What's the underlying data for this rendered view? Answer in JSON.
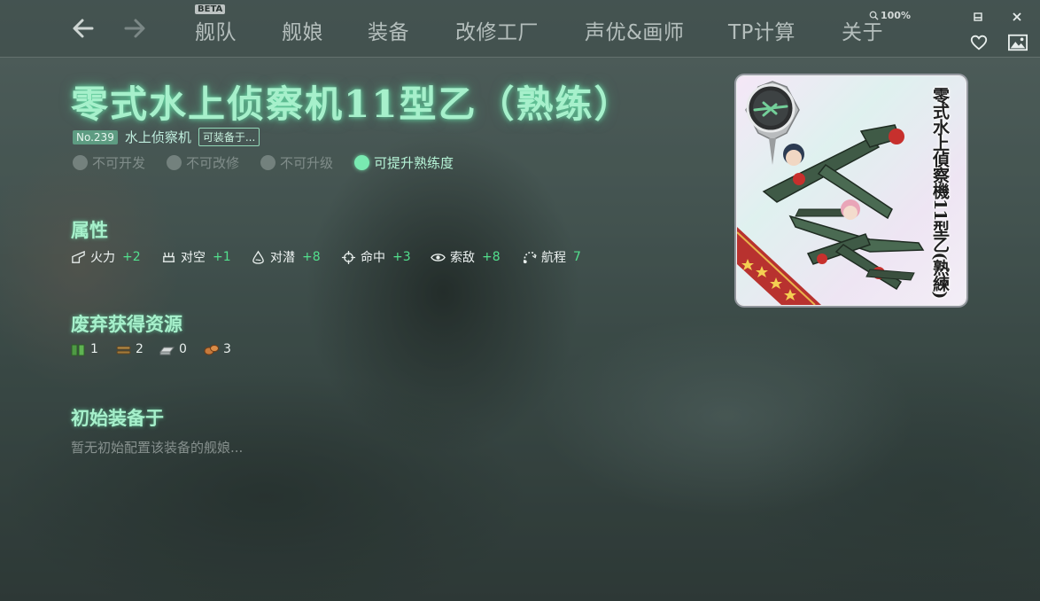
{
  "nav": {
    "beta_badge": "BETA",
    "tabs": [
      "舰队",
      "舰娘",
      "装备",
      "改修工厂",
      "声优&画师",
      "TP计算",
      "关于"
    ],
    "zoom": "100%"
  },
  "equipment": {
    "name": "零式水上侦察机11型乙（熟练）",
    "number": "No.239",
    "type": "水上侦察机",
    "equippable_button": "可装备于...",
    "card_name": "零式水上偵察機11型乙(熟練)",
    "flags": [
      {
        "label": "不可开发",
        "active": false
      },
      {
        "label": "不可改修",
        "active": false
      },
      {
        "label": "不可升级",
        "active": false
      },
      {
        "label": "可提升熟练度",
        "active": true
      }
    ]
  },
  "sections": {
    "stats_title": "属性",
    "scrap_title": "废弃获得资源",
    "initial_title": "初始装备于",
    "initial_empty": "暂无初始配置该装备的舰娘..."
  },
  "stats": [
    {
      "icon": "firepower-icon",
      "label": "火力",
      "value": "+2"
    },
    {
      "icon": "anti-air-icon",
      "label": "对空",
      "value": "+1"
    },
    {
      "icon": "anti-submarine-icon",
      "label": "对潜",
      "value": "+8"
    },
    {
      "icon": "accuracy-icon",
      "label": "命中",
      "value": "+3"
    },
    {
      "icon": "los-icon",
      "label": "索敌",
      "value": "+8"
    },
    {
      "icon": "range-icon",
      "label": "航程",
      "value": "7"
    }
  ],
  "scrap": [
    {
      "icon": "fuel-icon",
      "value": "1"
    },
    {
      "icon": "ammo-icon",
      "value": "2"
    },
    {
      "icon": "steel-icon",
      "value": "0"
    },
    {
      "icon": "bauxite-icon",
      "value": "3"
    }
  ],
  "colors": {
    "accent_green": "#a6f0cb",
    "stat_value_green": "#52e08d",
    "active_dot": "#79eab1"
  }
}
